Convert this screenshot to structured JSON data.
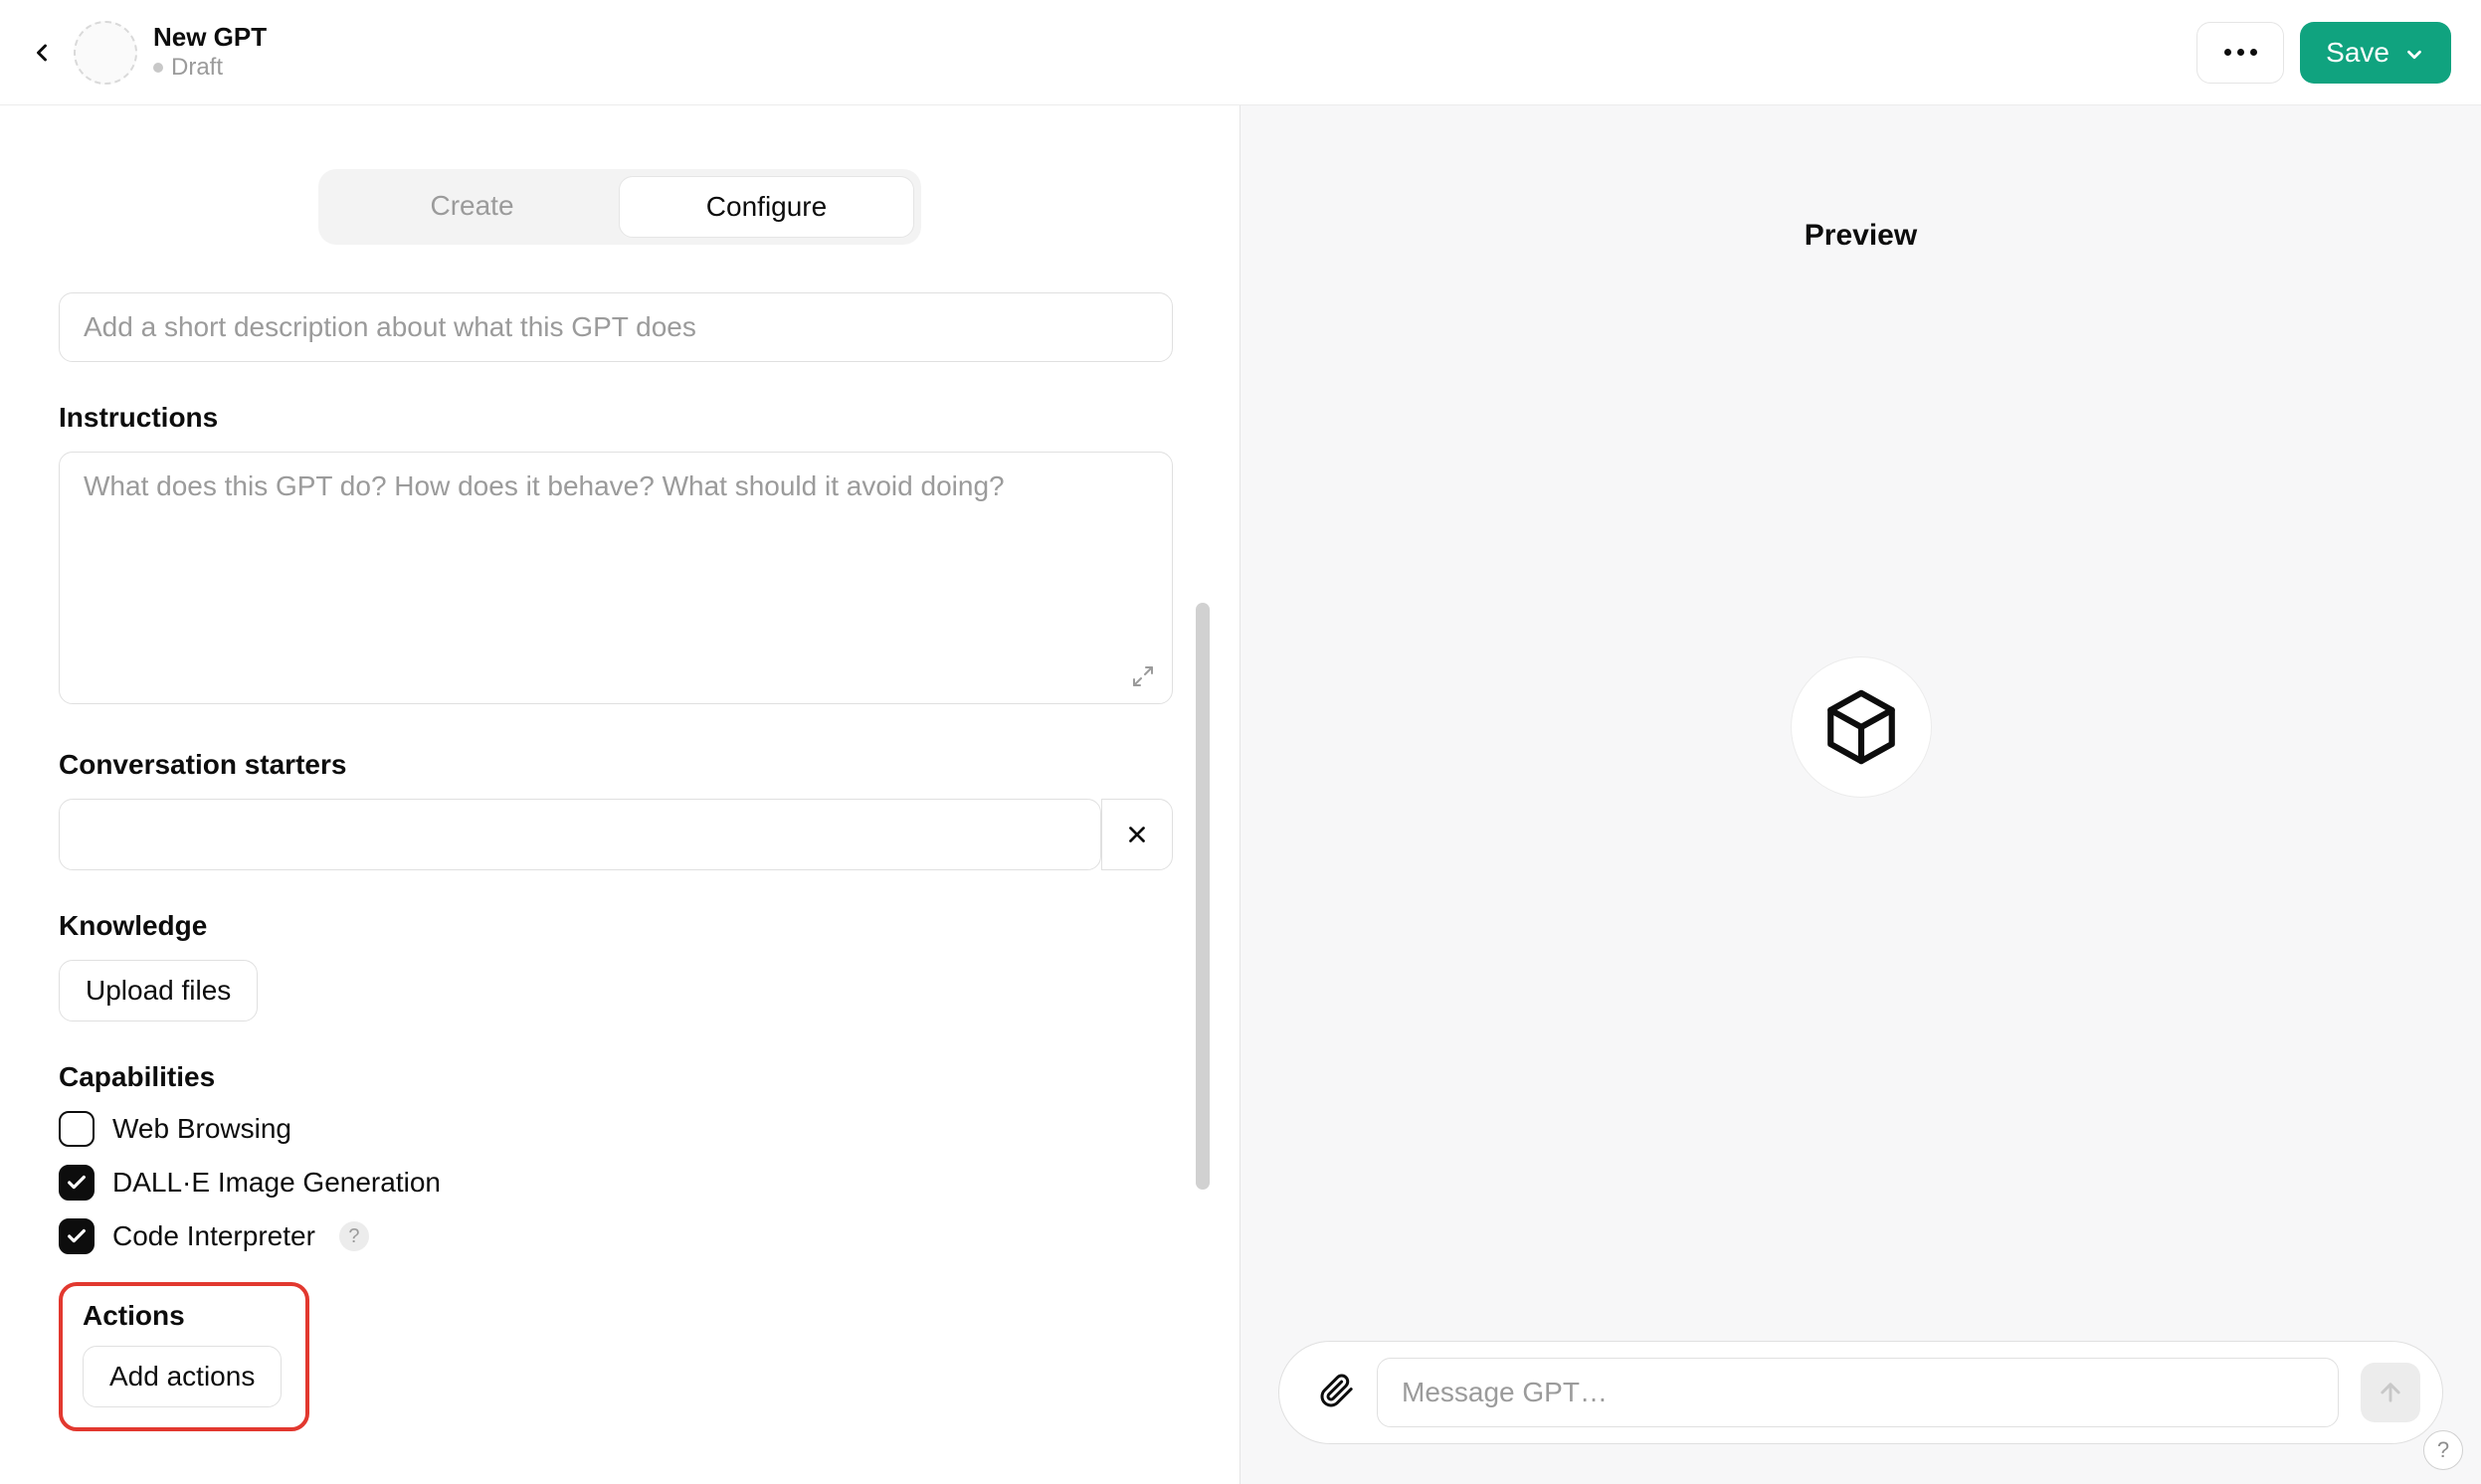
{
  "header": {
    "title": "New GPT",
    "status": "Draft",
    "more_aria": "More options",
    "save_label": "Save"
  },
  "tabs": {
    "create": "Create",
    "configure": "Configure",
    "active": "configure"
  },
  "form": {
    "description_placeholder": "Add a short description about what this GPT does",
    "instructions_label": "Instructions",
    "instructions_placeholder": "What does this GPT do? How does it behave? What should it avoid doing?",
    "starters_label": "Conversation starters",
    "knowledge_label": "Knowledge",
    "upload_label": "Upload files",
    "capabilities_label": "Capabilities",
    "capabilities": [
      {
        "label": "Web Browsing",
        "checked": false,
        "help": false
      },
      {
        "label": "DALL·E Image Generation",
        "checked": true,
        "help": false
      },
      {
        "label": "Code Interpreter",
        "checked": true,
        "help": true
      }
    ],
    "actions_label": "Actions",
    "add_actions_label": "Add actions"
  },
  "preview": {
    "title": "Preview",
    "message_placeholder": "Message GPT…"
  }
}
